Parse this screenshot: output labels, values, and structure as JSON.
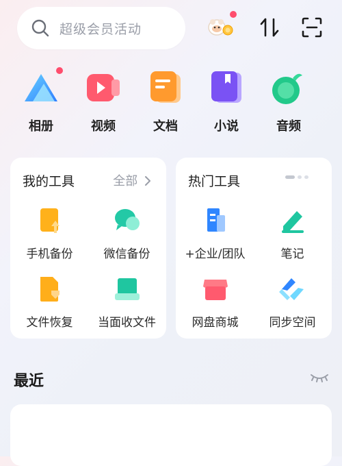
{
  "search": {
    "placeholder": "超级会员活动",
    "icon": "search-icon"
  },
  "header_icons": [
    "mascot-icon",
    "sort-icon",
    "scan-icon"
  ],
  "apps": [
    {
      "label": "相册",
      "icon": "album-icon",
      "badge": true
    },
    {
      "label": "视频",
      "icon": "video-icon"
    },
    {
      "label": "文档",
      "icon": "document-icon"
    },
    {
      "label": "小说",
      "icon": "novel-icon"
    },
    {
      "label": "音频",
      "icon": "audio-icon"
    }
  ],
  "my_tools": {
    "title": "我的工具",
    "more": "全部",
    "items": [
      {
        "label": "手机备份",
        "icon": "phone-backup-icon"
      },
      {
        "label": "微信备份",
        "icon": "wechat-backup-icon"
      },
      {
        "label": "文件恢复",
        "icon": "file-restore-icon"
      },
      {
        "label": "当面收文件",
        "icon": "receive-file-icon"
      }
    ]
  },
  "hot_tools": {
    "title": "热门工具",
    "items": [
      {
        "label": "+企业/团队",
        "icon": "enterprise-icon"
      },
      {
        "label": "笔记",
        "icon": "note-icon"
      },
      {
        "label": "网盘商城",
        "icon": "store-icon"
      },
      {
        "label": "同步空间",
        "icon": "sync-space-icon"
      }
    ]
  },
  "recent": {
    "title": "最近",
    "icon": "eye-closed-icon"
  },
  "colors": {
    "accent_blue": "#3a8dff",
    "badge_red": "#ff4d6d",
    "muted": "#9a9ea8"
  }
}
